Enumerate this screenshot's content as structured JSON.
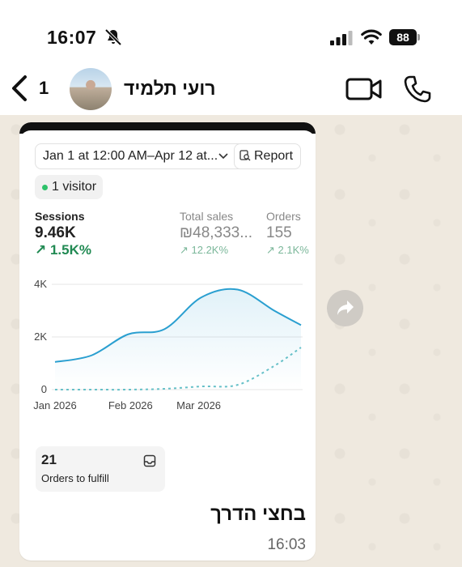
{
  "status_bar": {
    "time": "16:07",
    "battery": "88"
  },
  "header": {
    "back_count": "1",
    "contact_name": "רועי תלמיד"
  },
  "card": {
    "date_range": "Jan 1 at 12:00 AM–Apr 12 at...",
    "report_label": "Report",
    "visitor_label": "1 visitor",
    "metrics": [
      {
        "label": "Sessions",
        "value": "9.46K",
        "change": "↗ 1.5K%"
      },
      {
        "label": "Total sales",
        "value": "₪48,333...",
        "change": "↗ 12.2K%"
      },
      {
        "label": "Orders",
        "value": "155",
        "change": "↗ 2.1K%"
      }
    ],
    "fulfill": {
      "count": "21",
      "label": "Orders to fulfill"
    }
  },
  "chart_data": {
    "type": "line",
    "title": "",
    "xlabel": "",
    "ylabel": "",
    "x_ticks": [
      "Jan 2026",
      "Feb 2026",
      "Mar 2026"
    ],
    "y_ticks": [
      "0",
      "2K",
      "4K"
    ],
    "ylim": [
      0,
      4000
    ],
    "grid": true,
    "x": [
      0,
      15,
      30,
      45,
      60,
      75,
      90,
      101
    ],
    "series": [
      {
        "style": "solid",
        "color": "#2a9fd0",
        "values": [
          1050,
          1300,
          2100,
          2300,
          3500,
          3800,
          3000,
          2450
        ]
      },
      {
        "style": "dashed",
        "color": "#66c0c8",
        "values": [
          0,
          0,
          0,
          30,
          120,
          180,
          900,
          1600
        ]
      }
    ]
  },
  "message": {
    "text": "בחצי הדרך",
    "time": "16:03"
  },
  "colors": {
    "accent": "#2a9fd0",
    "positive": "#218a53",
    "wallpaper": "#efe9df"
  }
}
